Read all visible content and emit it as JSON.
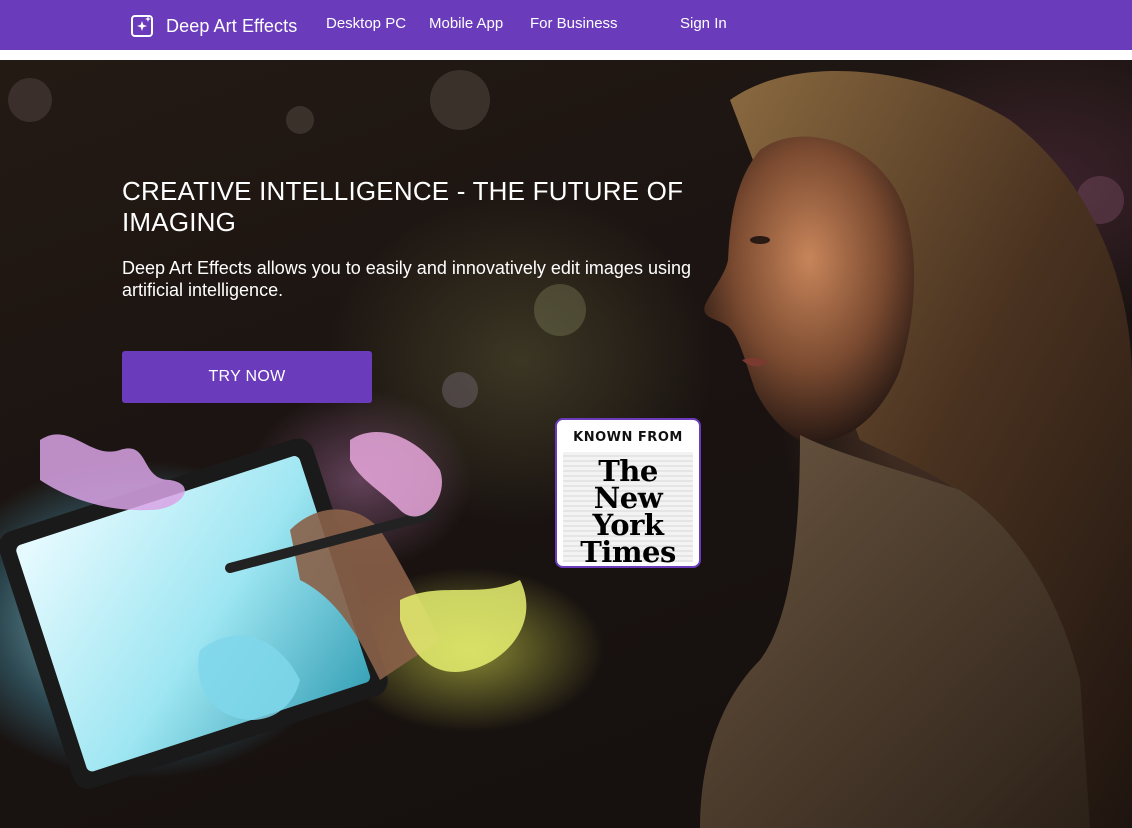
{
  "navbar": {
    "brand": "Deep Art Effects",
    "brand_icon": "sparkle-square-icon",
    "links": [
      "Desktop PC",
      "Mobile App",
      "For Business"
    ],
    "sign_in": "Sign In",
    "color": "#6a3cbc"
  },
  "hero": {
    "title": "CREATIVE INTELLIGENCE - THE FUTURE OF IMAGING",
    "subtitle": "Deep Art Effects allows you to easily and innovatively edit images using artificial intelligence.",
    "cta": "TRY NOW"
  },
  "press": {
    "label": "KNOWN FROM",
    "logo_lines": [
      "The",
      "New York",
      "Times"
    ]
  }
}
